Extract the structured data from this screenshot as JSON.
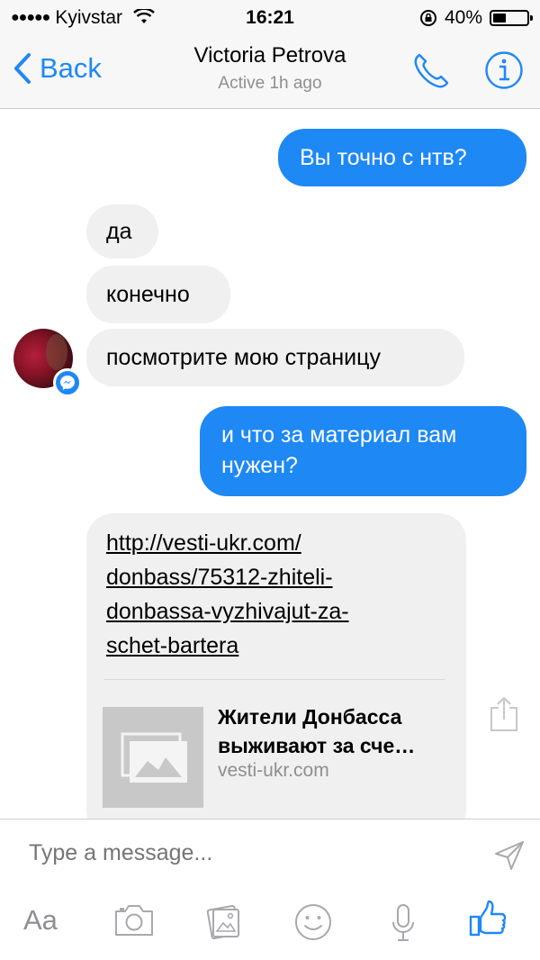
{
  "status_bar": {
    "carrier": "Kyivstar",
    "time": "16:21",
    "battery": "40%",
    "battery_level": 0.4
  },
  "nav": {
    "back_label": "Back",
    "contact_name": "Victoria Petrova",
    "status": "Active 1h ago"
  },
  "messages": [
    {
      "side": "out",
      "text": "Вы точно с нтв?"
    },
    {
      "side": "in",
      "text": "да"
    },
    {
      "side": "in",
      "text": "конечно"
    },
    {
      "side": "in",
      "text": "посмотрите мою страницу"
    },
    {
      "side": "out",
      "text": "и что за материал вам нужен?"
    }
  ],
  "link_message": {
    "url": "http://vesti-ukr.com/\ndonbass/75312-zhiteli-\ndonbassa-vyzhivajut-za-\nschet-bartera",
    "preview_title": "Жители Донбасса выживают за сче…",
    "preview_domain": "vesti-ukr.com"
  },
  "composer": {
    "placeholder": "Type a message...",
    "text_format_label": "Aa"
  },
  "colors": {
    "accent": "#1e88f5",
    "incoming_bubble": "#f0f0f0",
    "bar_background": "#f7f7f7"
  },
  "icons": [
    "signal-dots-icon",
    "wifi-icon",
    "rotation-lock-icon",
    "battery-icon",
    "chevron-left-icon",
    "phone-icon",
    "info-icon",
    "messenger-badge-icon",
    "image-placeholder-icon",
    "share-icon",
    "send-icon",
    "camera-icon",
    "gallery-icon",
    "emoji-icon",
    "microphone-icon",
    "thumbs-up-icon"
  ]
}
